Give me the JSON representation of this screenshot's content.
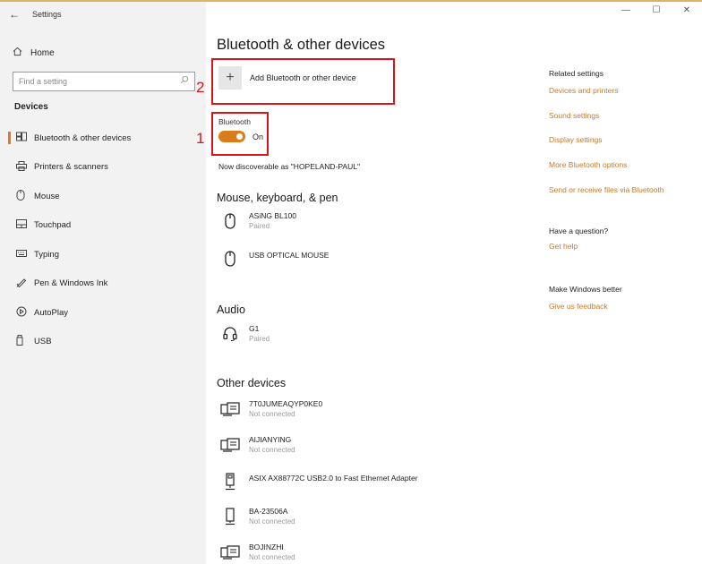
{
  "window": {
    "back_glyph": "←",
    "title": "Settings",
    "minimize_glyph": "—",
    "maximize_glyph": "☐",
    "close_glyph": "✕"
  },
  "sidebar": {
    "home_label": "Home",
    "search_placeholder": "Find a setting",
    "section_label": "Devices",
    "items": [
      {
        "label": "Bluetooth & other devices",
        "icon": "bluetooth-devices-icon",
        "active": true
      },
      {
        "label": "Printers & scanners",
        "icon": "printer-icon"
      },
      {
        "label": "Mouse",
        "icon": "mouse-icon"
      },
      {
        "label": "Touchpad",
        "icon": "touchpad-icon"
      },
      {
        "label": "Typing",
        "icon": "keyboard-icon"
      },
      {
        "label": "Pen & Windows Ink",
        "icon": "pen-icon"
      },
      {
        "label": "AutoPlay",
        "icon": "autoplay-icon"
      },
      {
        "label": "USB",
        "icon": "usb-icon"
      }
    ]
  },
  "main": {
    "title": "Bluetooth & other devices",
    "add_device_label": "Add Bluetooth or other device",
    "bluetooth_label": "Bluetooth",
    "bluetooth_state": "On",
    "discoverable_text": "Now discoverable as \"HOPELAND-PAUL\"",
    "groups": {
      "mouse": {
        "title": "Mouse, keyboard, & pen",
        "devices": [
          {
            "name": "ASiNG BL100",
            "status": "Paired",
            "icon": "mouse-icon"
          },
          {
            "name": "USB OPTICAL MOUSE",
            "status": "",
            "icon": "mouse-icon"
          }
        ]
      },
      "audio": {
        "title": "Audio",
        "devices": [
          {
            "name": "G1",
            "status": "Paired",
            "icon": "headset-icon"
          }
        ]
      },
      "other": {
        "title": "Other devices",
        "devices": [
          {
            "name": "7T0JUMEAQYP0KE0",
            "status": "Not connected",
            "icon": "network-device-icon"
          },
          {
            "name": "AIJIANYING",
            "status": "Not connected",
            "icon": "network-device-icon"
          },
          {
            "name": "ASIX AX88772C USB2.0 to Fast Ethernet Adapter",
            "status": "",
            "icon": "usb-adapter-icon"
          },
          {
            "name": "BA-23506A",
            "status": "Not connected",
            "icon": "device-icon"
          },
          {
            "name": "BOJINZHI",
            "status": "Not connected",
            "icon": "network-device-icon"
          }
        ]
      }
    }
  },
  "right": {
    "related_title": "Related settings",
    "related_links": [
      "Devices and printers",
      "Sound settings",
      "Display settings",
      "More Bluetooth options",
      "Send or receive files via Bluetooth"
    ],
    "question_title": "Have a question?",
    "question_link": "Get help",
    "better_title": "Make Windows better",
    "better_link": "Give us feedback"
  },
  "annotations": {
    "one": "1",
    "two": "2"
  },
  "colors": {
    "accent": "#d97c1b",
    "link": "#c47a2c",
    "annotation": "#d9141a"
  }
}
